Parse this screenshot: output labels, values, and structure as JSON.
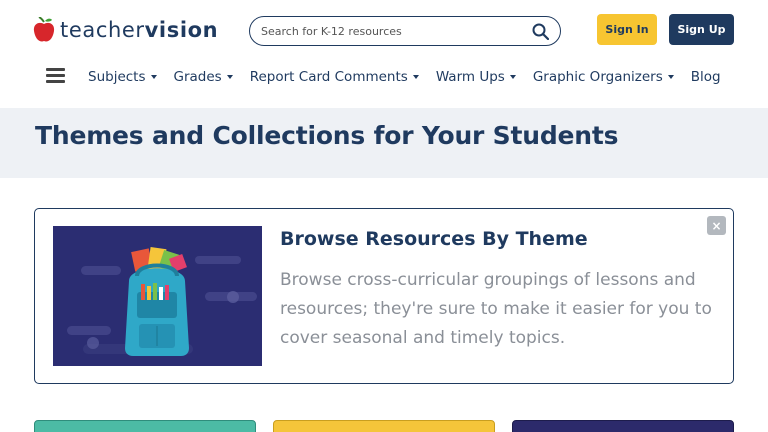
{
  "logo": {
    "word_regular": "teacher",
    "word_bold": "vision"
  },
  "search": {
    "placeholder": "Search for K-12 resources"
  },
  "auth": {
    "sign_in": "Sign In",
    "sign_up": "Sign Up"
  },
  "nav": {
    "items": [
      {
        "label": "Subjects",
        "dropdown": true
      },
      {
        "label": "Grades",
        "dropdown": true
      },
      {
        "label": "Report Card Comments",
        "dropdown": true
      },
      {
        "label": "Warm Ups",
        "dropdown": true
      },
      {
        "label": "Graphic Organizers",
        "dropdown": true
      },
      {
        "label": "Blog",
        "dropdown": false
      }
    ]
  },
  "page": {
    "title": "Themes and Collections for Your Students"
  },
  "card": {
    "heading": "Browse Resources By Theme",
    "description": "Browse cross-curricular groupings of lessons and resources; they're sure to make it easier for you to cover seasonal and timely topics.",
    "close_label": "×",
    "image_icon": "backpack-illustration"
  },
  "colors": {
    "brand_navy": "#1f3a5f",
    "accent_yellow": "#f7c531",
    "tile_teal": "#4cbba5",
    "tile_yellow": "#f5c53a",
    "tile_indigo": "#2c2a6b"
  }
}
